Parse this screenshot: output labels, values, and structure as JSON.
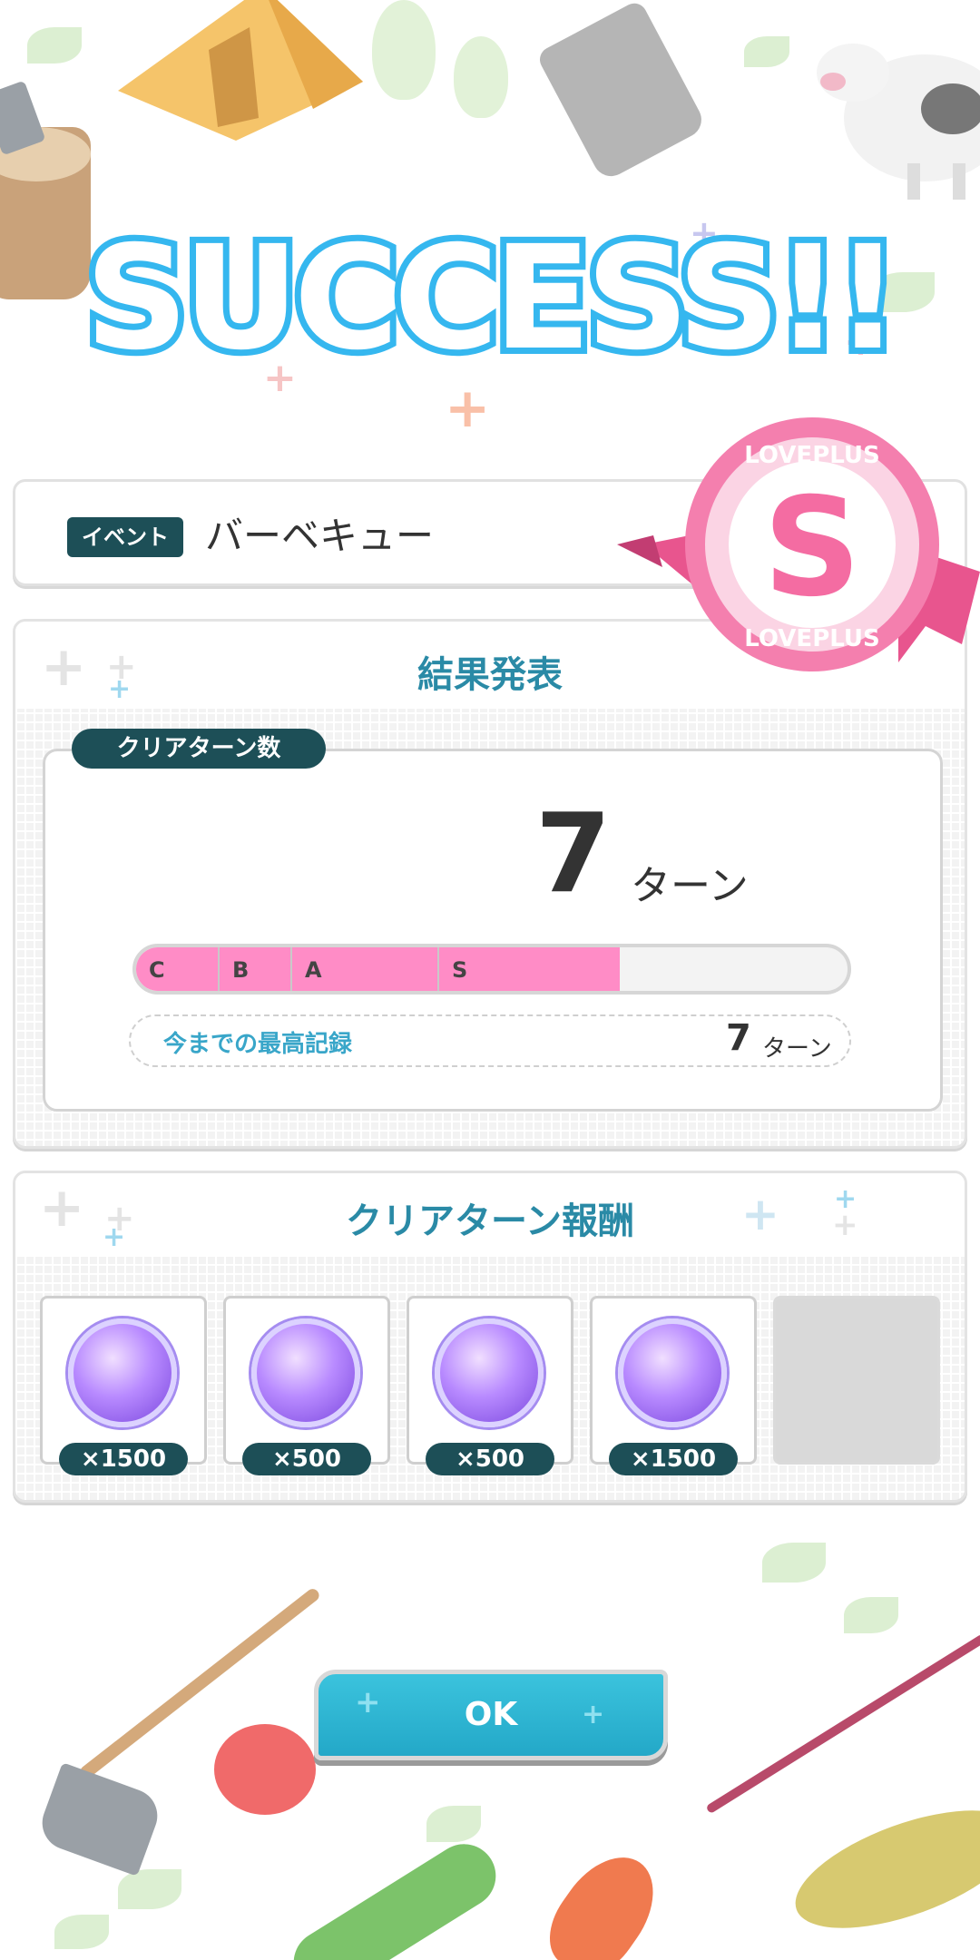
{
  "colors": {
    "accent_teal": "#1d4f57",
    "title_blue": "#2a8aa6",
    "bar_pink": "#ff8cc6",
    "ok_blue": "#3bc3dd"
  },
  "title": {
    "text": "SUCCESS!!"
  },
  "event": {
    "tag": "イベント",
    "name": "バーベキュー"
  },
  "rank_badge": {
    "letter": "S",
    "ring_text": "LOVEPLUS",
    "ring_text_bottom": "LOVEPLUS"
  },
  "result": {
    "title": "結果発表",
    "label": "クリアターン数",
    "turns": "7",
    "turn_unit": "ターン",
    "progress_fraction": 0.68,
    "grades": [
      "C",
      "B",
      "A",
      "S"
    ],
    "best_label": "今までの最高記録",
    "best_value": "7",
    "best_unit": "ターン"
  },
  "rewards": {
    "title": "クリアターン報酬",
    "items": [
      {
        "icon": "backpack-icon",
        "count": "×1500"
      },
      {
        "icon": "backpack-icon",
        "count": "×500"
      },
      {
        "icon": "backpack-icon",
        "count": "×500"
      },
      {
        "icon": "backpack-icon",
        "count": "×1500"
      }
    ]
  },
  "ok_button": {
    "label": "OK"
  }
}
